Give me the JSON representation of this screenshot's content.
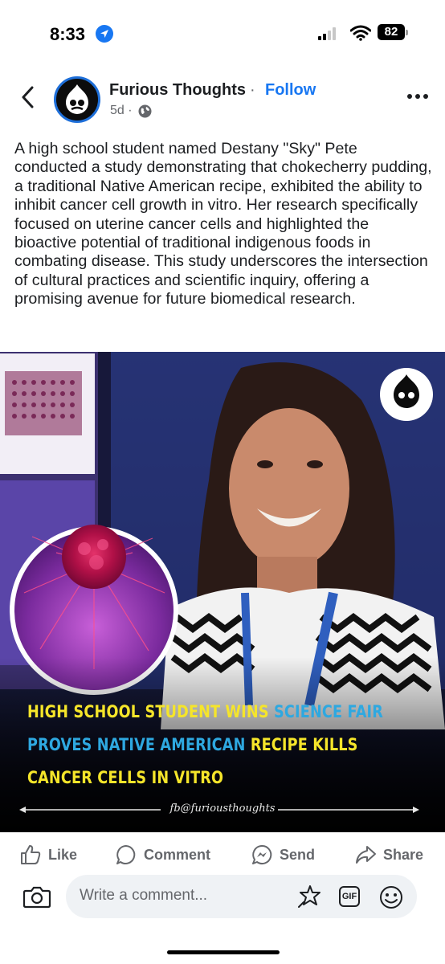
{
  "status_bar": {
    "time": "8:33",
    "battery": "82"
  },
  "header": {
    "page_name": "Furious Thoughts",
    "separator": "·",
    "follow_label": "Follow",
    "time_ago": "5d ·"
  },
  "post": {
    "text": "A high school student named Destany \"Sky\" Pete conducted a study demonstrating that chokecherry pudding, a traditional Native American recipe, exhibited the ability to inhibit cancer cell growth in vitro. Her research specifically focused on uterine cancer cells and highlighted the bioactive potential of traditional indigenous foods in combating disease. This study underscores the intersection of cultural practices and scientific inquiry, offering a promising avenue for future biomedical research."
  },
  "image": {
    "caption_line1_a": "HIGH SCHOOL STUDENT WINS ",
    "caption_line1_b": "SCIENCE FAIR",
    "caption_line2_a": "PROVES NATIVE AMERICAN",
    "caption_line2_b": " RECIPE KILLS",
    "caption_line3": "CANCER CELLS IN VITRO",
    "watermark": "fb@furiousthoughts"
  },
  "actions": {
    "like": "Like",
    "comment": "Comment",
    "send": "Send",
    "share": "Share"
  },
  "comment_bar": {
    "placeholder": "Write a comment...",
    "gif_label": "GIF"
  },
  "colors": {
    "accent": "#1877f2",
    "caption_yellow": "#f5e52a",
    "caption_blue": "#2ea8e0"
  }
}
